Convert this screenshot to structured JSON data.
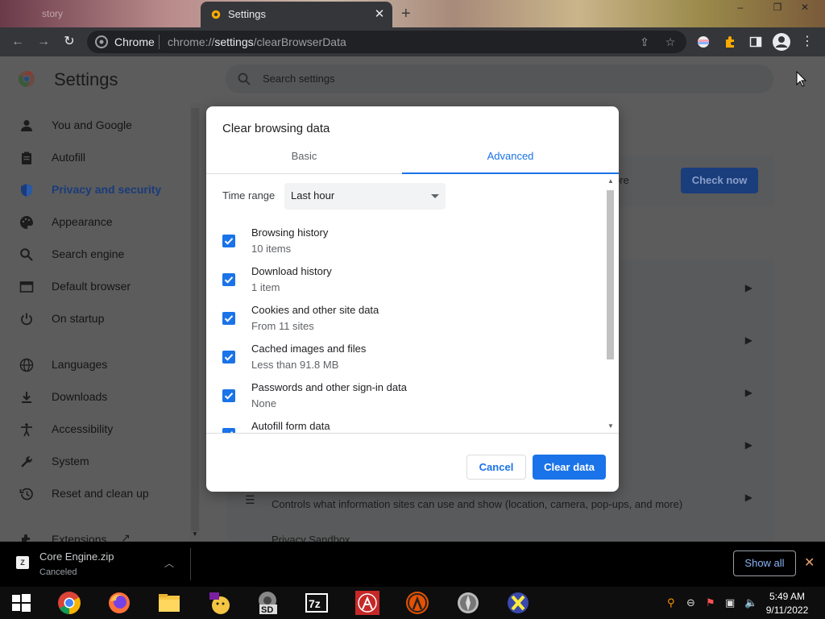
{
  "browser": {
    "inactive_tab_label": "story",
    "active_tab_label": "Settings",
    "omnibox_chip": "Chrome",
    "url_prefix": "chrome://",
    "url_host": "settings",
    "url_path": "/clearBrowserData"
  },
  "settings": {
    "title": "Settings",
    "search_placeholder": "Search settings",
    "sidebar": [
      {
        "label": "You and Google",
        "icon": "person-icon"
      },
      {
        "label": "Autofill",
        "icon": "clipboard-icon"
      },
      {
        "label": "Privacy and security",
        "icon": "shield-icon",
        "active": true
      },
      {
        "label": "Appearance",
        "icon": "palette-icon"
      },
      {
        "label": "Search engine",
        "icon": "search-icon"
      },
      {
        "label": "Default browser",
        "icon": "browser-icon"
      },
      {
        "label": "On startup",
        "icon": "power-icon"
      },
      {
        "label": "Languages",
        "icon": "globe-icon"
      },
      {
        "label": "Downloads",
        "icon": "download-icon"
      },
      {
        "label": "Accessibility",
        "icon": "accessibility-icon"
      },
      {
        "label": "System",
        "icon": "wrench-icon"
      },
      {
        "label": "Reset and clean up",
        "icon": "restore-icon"
      },
      {
        "label": "Extensions",
        "icon": "puzzle-icon"
      }
    ],
    "bg_more_text": "ore",
    "check_now": "Check now",
    "bg_site_settings_desc": "Controls what information sites can use and show (location, camera, pop-ups, and more)",
    "bg_privacy_sandbox": "Privacy Sandbox",
    "bg_partial": "s"
  },
  "dialog": {
    "title": "Clear browsing data",
    "tab_basic": "Basic",
    "tab_advanced": "Advanced",
    "time_range_label": "Time range",
    "time_range_value": "Last hour",
    "options": [
      {
        "title": "Browsing history",
        "sub": "10 items",
        "checked": true
      },
      {
        "title": "Download history",
        "sub": "1 item",
        "checked": true
      },
      {
        "title": "Cookies and other site data",
        "sub": "From 11 sites",
        "checked": true
      },
      {
        "title": "Cached images and files",
        "sub": "Less than 91.8 MB",
        "checked": true
      },
      {
        "title": "Passwords and other sign-in data",
        "sub": "None",
        "checked": true
      },
      {
        "title": "Autofill form data",
        "sub": "",
        "checked": true
      }
    ],
    "cancel": "Cancel",
    "clear": "Clear data"
  },
  "download_bar": {
    "file_name": "Core Engine.zip",
    "status": "Canceled",
    "show_all": "Show all"
  },
  "taskbar": {
    "time": "5:49 AM",
    "date": "9/11/2022"
  },
  "colors": {
    "accent": "#1a73e8",
    "toolbar": "#35363a"
  }
}
